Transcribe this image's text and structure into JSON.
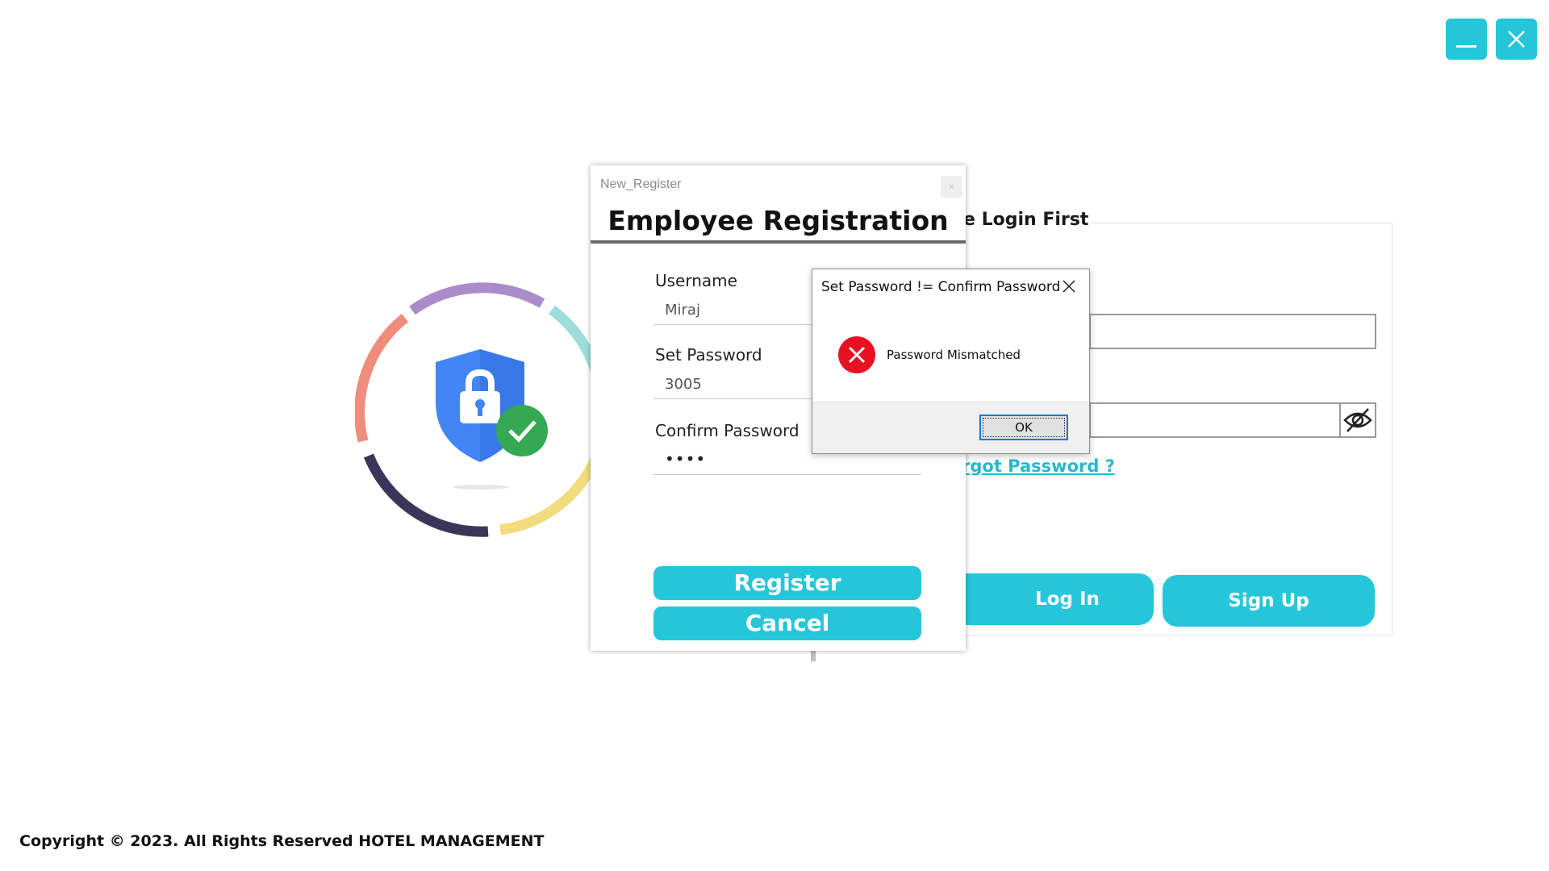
{
  "window_controls": {
    "minimize_icon": "minimize-icon",
    "close_icon": "close-icon",
    "accent": "#26c6da"
  },
  "login": {
    "title_partial": "e Login First",
    "forgot_link": "rgot Password ?",
    "login_button": "Log In",
    "signup_button": "Sign Up",
    "eye_icon": "eye-slash-icon"
  },
  "register": {
    "window_title": "New_Register",
    "close_glyph": "×",
    "heading": "Employee Registration",
    "fields": [
      {
        "label": "Username",
        "value": "Miraj"
      },
      {
        "label": "Set Password",
        "value": "3005"
      },
      {
        "label": "Confirm Password",
        "value": "••••"
      }
    ],
    "register_button": "Register",
    "cancel_button": "Cancel"
  },
  "message_box": {
    "title": "Set Password != Confirm Password",
    "message": "Password Mismatched",
    "ok_button": "OK",
    "icon": "error-icon",
    "icon_color": "#e81123"
  },
  "footer": {
    "copyright": "Copyright © 2023. All Rights Reserved HOTEL MANAGEMENT"
  }
}
